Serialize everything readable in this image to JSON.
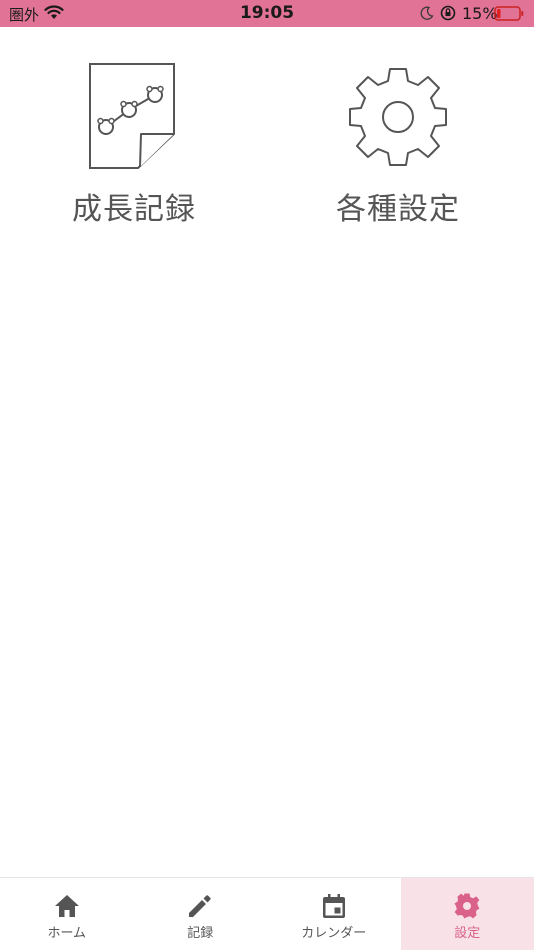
{
  "status_bar": {
    "carrier": "圏外",
    "time": "19:05",
    "battery_percent": "15%"
  },
  "tiles": [
    {
      "label": "成長記録",
      "icon": "growth-chart-icon"
    },
    {
      "label": "各種設定",
      "icon": "gear-icon"
    }
  ],
  "tab_bar": {
    "items": [
      {
        "label": "ホーム",
        "icon": "home-icon",
        "active": false
      },
      {
        "label": "記録",
        "icon": "pencil-icon",
        "active": false
      },
      {
        "label": "カレンダー",
        "icon": "calendar-icon",
        "active": false
      },
      {
        "label": "設定",
        "icon": "gear-icon",
        "active": true
      }
    ]
  },
  "colors": {
    "status_bar": "#e07396",
    "active_tab_bg": "#f9e1e8",
    "active_tab_fg": "#d9618a",
    "icon_gray": "#555555"
  }
}
